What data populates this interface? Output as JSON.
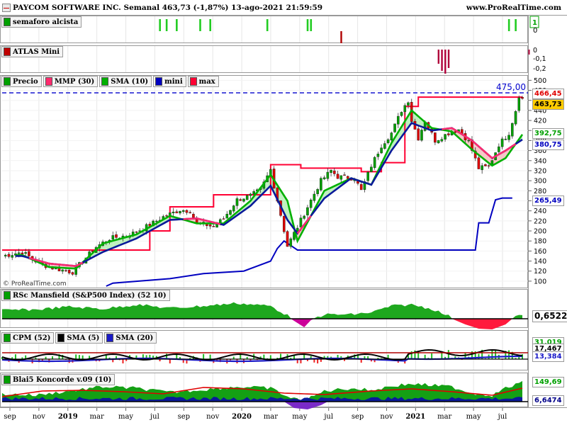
{
  "header": {
    "title": "PAYCOM SOFTWARE INC. Semanal 463,73 (-1,87%) 13-ago-2021 21:59:59",
    "url": "www.ProRealTime.com",
    "copyright": "© ProRealTime.com"
  },
  "colors": {
    "up": "#00a000",
    "down": "#e00000",
    "mmp": "#ff2b6e",
    "sma10": "#00b000",
    "mini": "#0000c0",
    "max": "#ff0033",
    "navy": "#0a1a9a"
  },
  "panels": {
    "semaforo": {
      "label": "semaforo alcista",
      "scale": [
        "1",
        "0"
      ]
    },
    "atlas": {
      "label": "ATLAS Mini",
      "scale": [
        "0",
        "-0,1",
        "-0,2"
      ]
    },
    "price": {
      "legend": [
        "Precio",
        "MMP (30)",
        "SMA (10)",
        "mini",
        "max"
      ],
      "scale": [
        "500",
        "480",
        "460",
        "440",
        "420",
        "400",
        "380",
        "360",
        "340",
        "320",
        "300",
        "280",
        "260",
        "240",
        "220",
        "200",
        "180",
        "160",
        "140",
        "120",
        "100"
      ],
      "level_label": "475,00",
      "tags": {
        "max": "466,45",
        "last": "463,73",
        "sma10": "392,75",
        "mmp": "380,75",
        "mini": "265,49"
      }
    },
    "rsc": {
      "label": "RSc Mansfield (S&P500 Index) (52 10)",
      "tag": "0,6522"
    },
    "cpm": {
      "labels": [
        "CPM (52)",
        "SMA (5)",
        "SMA (20)"
      ],
      "tags": [
        "31,019",
        "17,467",
        "13,384"
      ]
    },
    "blai": {
      "label": "Blai5 Koncorde v.09 (10)",
      "tags": [
        "149,69",
        "6,6474"
      ]
    }
  },
  "x_axis": [
    "sep",
    "nov",
    "2019",
    "mar",
    "may",
    "jul",
    "sep",
    "nov",
    "2020",
    "mar",
    "may",
    "jul",
    "sep",
    "nov",
    "2021",
    "mar",
    "may",
    "jul"
  ],
  "chart_data": {
    "type": "candlestick",
    "title": "PAYCOM SOFTWARE INC. Semanal 463,73 (-1,87%) 13-ago-2021 21:59:59",
    "timeframe": "Semanal",
    "last_close": 463.73,
    "change_pct": -1.87,
    "x_range": [
      "2018-08",
      "2021-08"
    ],
    "y_range": [
      90,
      505
    ],
    "resistance_level": 475.0,
    "close_path": [
      [
        0,
        150
      ],
      [
        6,
        158
      ],
      [
        10,
        140
      ],
      [
        14,
        128
      ],
      [
        18,
        122
      ],
      [
        21,
        118
      ],
      [
        24,
        140
      ],
      [
        28,
        168
      ],
      [
        32,
        185
      ],
      [
        38,
        192
      ],
      [
        44,
        212
      ],
      [
        48,
        228
      ],
      [
        53,
        242
      ],
      [
        56,
        240
      ],
      [
        58,
        215
      ],
      [
        61,
        212
      ],
      [
        63,
        208
      ],
      [
        66,
        225
      ],
      [
        70,
        262
      ],
      [
        74,
        270
      ],
      [
        77,
        282
      ],
      [
        80,
        322
      ],
      [
        81,
        290
      ],
      [
        83,
        232
      ],
      [
        85,
        170
      ],
      [
        88,
        208
      ],
      [
        91,
        248
      ],
      [
        95,
        300
      ],
      [
        98,
        320
      ],
      [
        100,
        308
      ],
      [
        105,
        305
      ],
      [
        107,
        280
      ],
      [
        110,
        330
      ],
      [
        113,
        370
      ],
      [
        116,
        395
      ],
      [
        119,
        440
      ],
      [
        121,
        460
      ],
      [
        122,
        420
      ],
      [
        124,
        385
      ],
      [
        126,
        420
      ],
      [
        129,
        380
      ],
      [
        133,
        395
      ],
      [
        136,
        402
      ],
      [
        139,
        378
      ],
      [
        142,
        325
      ],
      [
        145,
        328
      ],
      [
        148,
        372
      ],
      [
        151,
        395
      ],
      [
        153,
        440
      ],
      [
        154,
        470
      ],
      [
        155,
        463.73
      ]
    ],
    "series": [
      {
        "name": "MMP (30)",
        "values": [
          [
            6,
            150
          ],
          [
            14,
            135
          ],
          [
            22,
            130
          ],
          [
            30,
            158
          ],
          [
            40,
            185
          ],
          [
            50,
            222
          ],
          [
            58,
            225
          ],
          [
            66,
            212
          ],
          [
            74,
            250
          ],
          [
            80,
            290
          ],
          [
            85,
            222
          ],
          [
            88,
            195
          ],
          [
            96,
            265
          ],
          [
            104,
            305
          ],
          [
            110,
            292
          ],
          [
            116,
            360
          ],
          [
            122,
            415
          ],
          [
            128,
            400
          ],
          [
            134,
            405
          ],
          [
            140,
            380
          ],
          [
            146,
            345
          ],
          [
            150,
            360
          ],
          [
            155,
            382
          ]
        ]
      },
      {
        "name": "SMA (10)",
        "values": [
          [
            6,
            152
          ],
          [
            14,
            128
          ],
          [
            22,
            125
          ],
          [
            30,
            175
          ],
          [
            40,
            193
          ],
          [
            50,
            230
          ],
          [
            58,
            215
          ],
          [
            66,
            215
          ],
          [
            74,
            260
          ],
          [
            80,
            312
          ],
          [
            85,
            260
          ],
          [
            88,
            180
          ],
          [
            96,
            280
          ],
          [
            104,
            305
          ],
          [
            110,
            292
          ],
          [
            116,
            375
          ],
          [
            122,
            440
          ],
          [
            128,
            405
          ],
          [
            134,
            398
          ],
          [
            140,
            362
          ],
          [
            146,
            330
          ],
          [
            150,
            345
          ],
          [
            155,
            392
          ]
        ]
      },
      {
        "name": "mini",
        "values": [
          [
            31,
            90
          ],
          [
            33,
            96
          ],
          [
            50,
            105
          ],
          [
            60,
            115
          ],
          [
            72,
            120
          ],
          [
            80,
            140
          ],
          [
            82,
            165
          ],
          [
            84,
            180
          ],
          [
            88,
            162
          ],
          [
            100,
            162
          ],
          [
            116,
            162
          ],
          [
            136,
            162
          ],
          [
            141,
            162
          ],
          [
            142,
            216
          ],
          [
            145,
            216
          ],
          [
            147,
            262
          ],
          [
            149,
            265.49
          ],
          [
            152,
            265.49
          ]
        ]
      },
      {
        "name": "max",
        "values": [
          [
            0,
            162
          ],
          [
            44,
            162
          ],
          [
            44,
            200
          ],
          [
            50,
            200
          ],
          [
            50,
            248
          ],
          [
            63,
            248
          ],
          [
            63,
            272
          ],
          [
            80,
            272
          ],
          [
            80,
            332
          ],
          [
            89,
            332
          ],
          [
            89,
            325
          ],
          [
            107,
            325
          ],
          [
            107,
            318
          ],
          [
            113,
            318
          ],
          [
            113,
            336
          ],
          [
            120,
            336
          ],
          [
            120,
            448
          ],
          [
            124,
            448
          ],
          [
            124,
            466.45
          ],
          [
            155,
            466.45
          ]
        ]
      }
    ],
    "indicators": {
      "rsc_last": 0.6522,
      "cpm_last": [
        31.019,
        17.467,
        13.384
      ],
      "koncorde_last": [
        149.69,
        6.6474
      ]
    }
  }
}
